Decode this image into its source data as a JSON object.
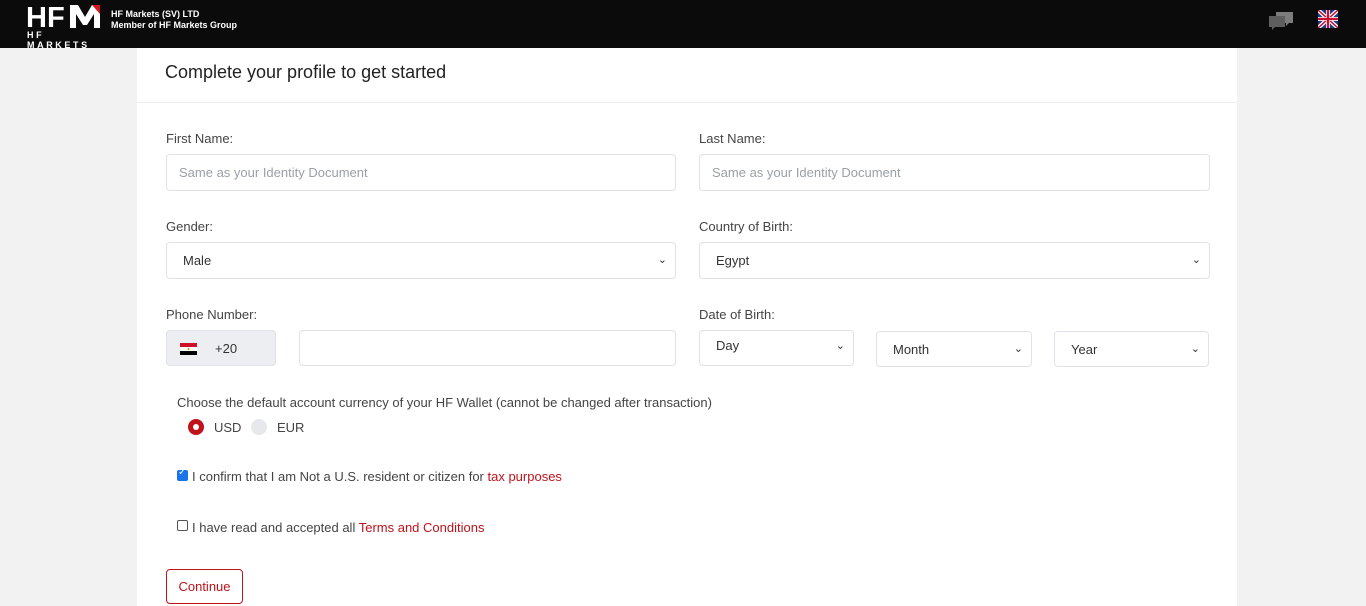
{
  "header": {
    "logo_text": "HFM",
    "logo_sub": "HF MARKETS",
    "company_line1": "HF Markets (SV) LTD",
    "company_line2": "Member of HF Markets Group",
    "chat_icon": "chat-bubbles-icon",
    "language_icon": "uk-flag-icon"
  },
  "form": {
    "title": "Complete your profile to get started",
    "first_name": {
      "label": "First Name:",
      "placeholder": "Same as your Identity Document",
      "value": ""
    },
    "last_name": {
      "label": "Last Name:",
      "placeholder": "Same as your Identity Document",
      "value": ""
    },
    "gender": {
      "label": "Gender:",
      "selected": "Male"
    },
    "country_of_birth": {
      "label": "Country of Birth:",
      "selected": "Egypt"
    },
    "phone": {
      "label": "Phone Number:",
      "country_code": "+20",
      "flag": "egypt-flag-icon",
      "value": ""
    },
    "date_of_birth": {
      "label": "Date of Birth:",
      "day": "Day",
      "month": "Month",
      "year": "Year"
    },
    "currency": {
      "question": "Choose the default account currency of your HF Wallet (cannot be changed after transaction)",
      "options": [
        {
          "label": "USD",
          "selected": true
        },
        {
          "label": "EUR",
          "selected": false
        }
      ]
    },
    "tax_confirm": {
      "text": "I confirm that I am Not a U.S. resident or citizen for ",
      "link": "tax purposes",
      "checked": true
    },
    "terms": {
      "text": "I have read and accepted all ",
      "link": "Terms and Conditions",
      "checked": false
    },
    "continue_label": "Continue"
  },
  "colors": {
    "brand_red": "#c0121a",
    "header_bg": "#0b0b0b",
    "page_bg": "#f2f2f2"
  }
}
